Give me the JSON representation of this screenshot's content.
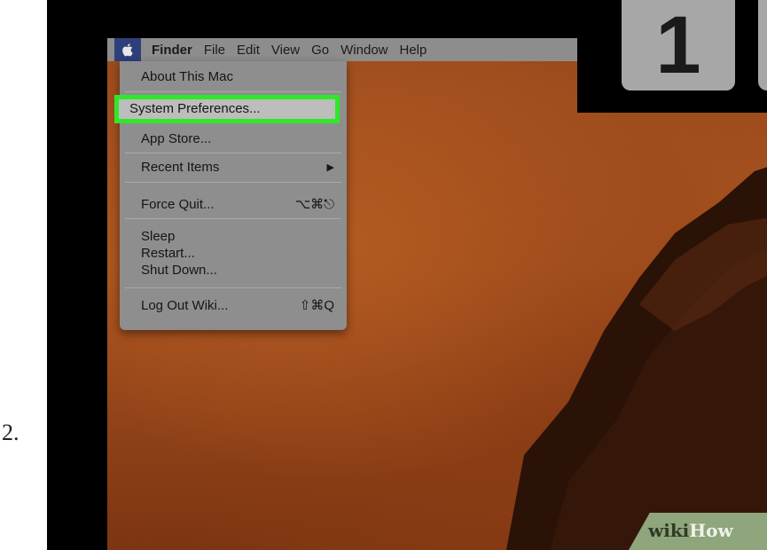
{
  "list_number": "2.",
  "menubar": {
    "apple_icon": "apple-icon",
    "items": [
      "Finder",
      "File",
      "Edit",
      "View",
      "Go",
      "Window",
      "Help"
    ]
  },
  "apple_menu": {
    "items": [
      {
        "label": "About This Mac",
        "shortcut": ""
      },
      {
        "label": "System Preferences...",
        "shortcut": ""
      },
      {
        "label": "App Store...",
        "shortcut": ""
      },
      {
        "label": "Recent Items",
        "shortcut": "▶"
      },
      {
        "label": "Force Quit...",
        "shortcut": "⌥⌘⎋"
      },
      {
        "label": "Sleep",
        "shortcut": ""
      },
      {
        "label": "Restart...",
        "shortcut": ""
      },
      {
        "label": "Shut Down...",
        "shortcut": ""
      },
      {
        "label": "Log Out Wiki...",
        "shortcut": "⇧⌘Q"
      }
    ]
  },
  "step_badge": "1",
  "watermark": {
    "wiki": "wiki",
    "how": "How"
  },
  "colors": {
    "highlight": "#2fe82a",
    "menu_bg": "#8e8e8e",
    "apple_bg": "#2f3f7a"
  }
}
